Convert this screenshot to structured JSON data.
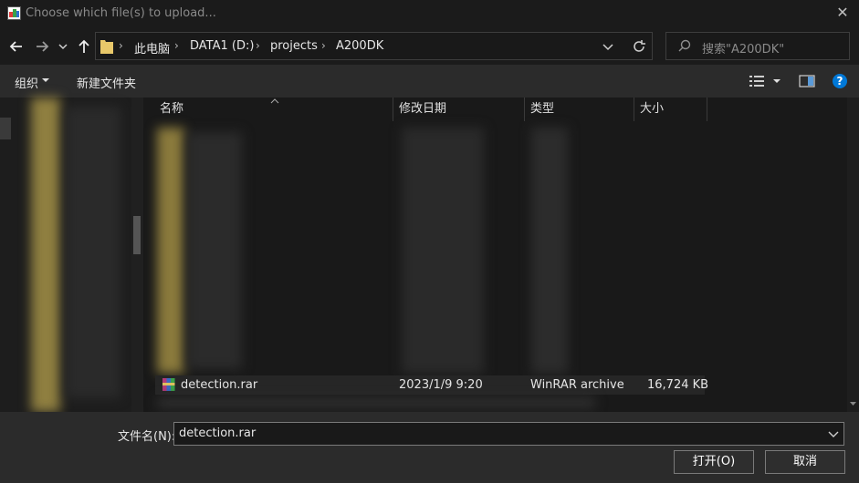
{
  "window": {
    "title": "Choose which file(s) to upload..."
  },
  "nav": {
    "breadcrumbs": [
      "此电脑",
      "DATA1 (D:)",
      "projects",
      "A200DK"
    ],
    "search_placeholder": "搜索\"A200DK\""
  },
  "toolbar": {
    "organize_label": "组织",
    "new_folder_label": "新建文件夹"
  },
  "columns": [
    "名称",
    "修改日期",
    "类型",
    "大小"
  ],
  "files": [
    {
      "name": "detection.rar",
      "modified": "2023/1/9 9:20",
      "type": "WinRAR archive",
      "size": "16,724 KB"
    }
  ],
  "footer": {
    "filename_label": "文件名(N):",
    "filename_value": "detection.rar",
    "open_label": "打开(O)",
    "cancel_label": "取消"
  },
  "colors": {
    "accent": "#0078d7",
    "background": "#191919",
    "toolbar": "#2b2b2b",
    "folder": "#e8c86a"
  }
}
